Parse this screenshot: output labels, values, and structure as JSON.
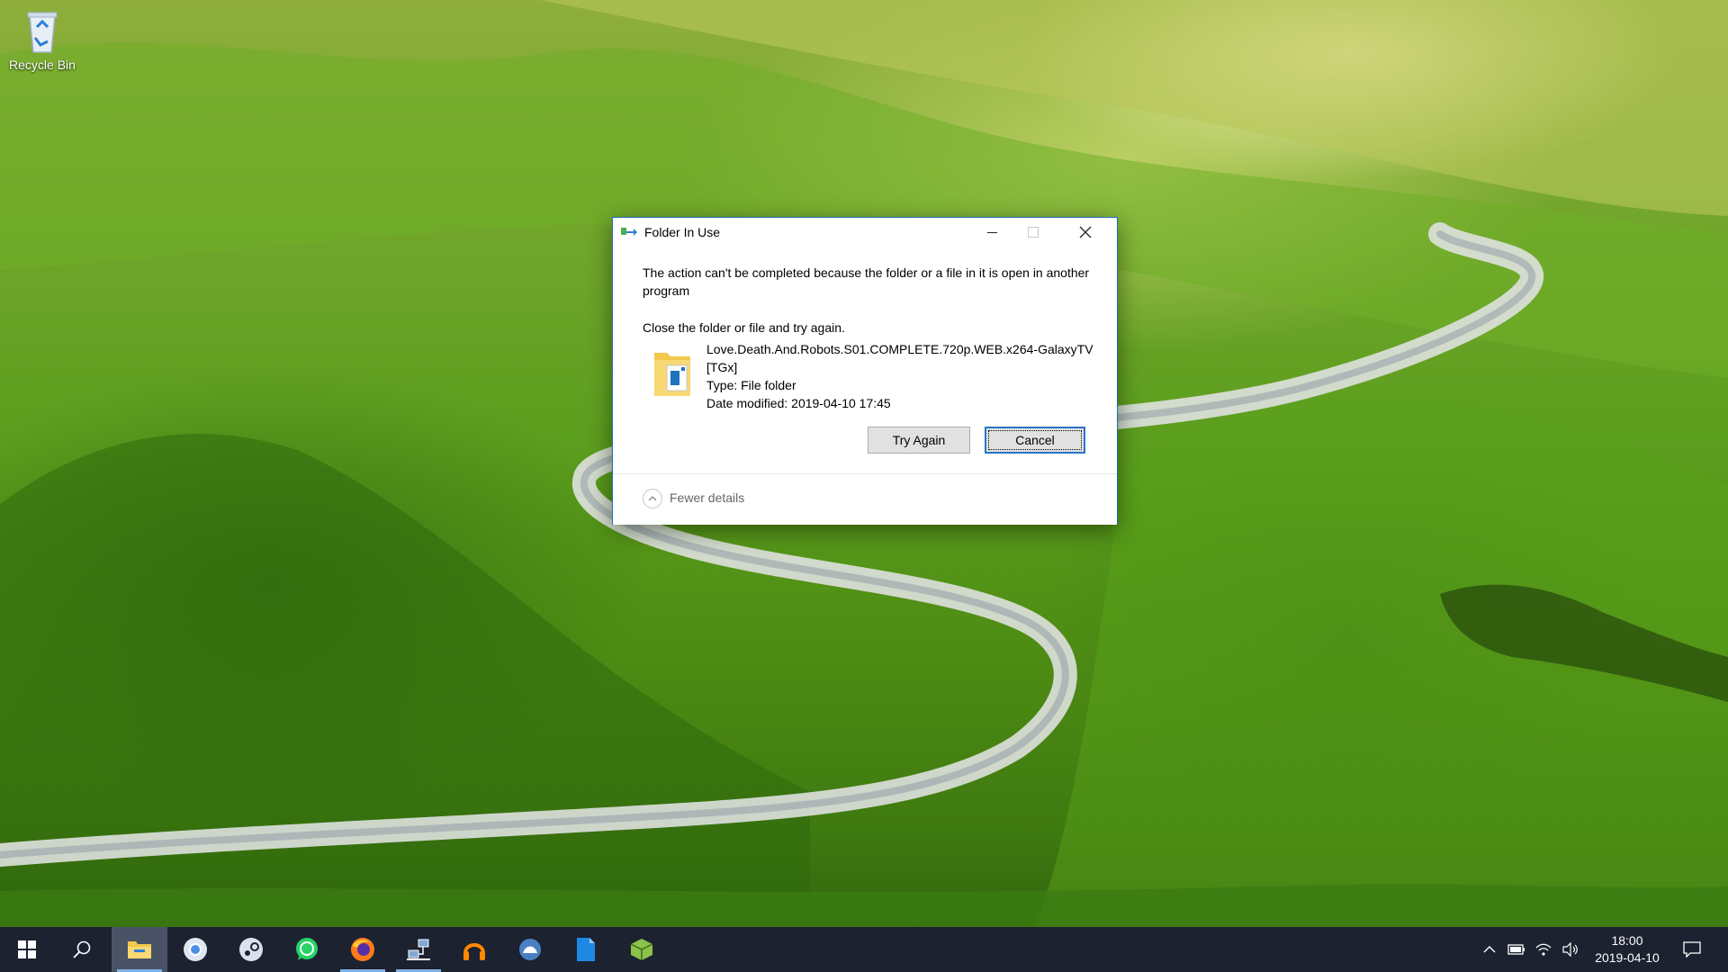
{
  "desktop": {
    "icons": [
      {
        "label": "Recycle Bin",
        "icon": "recycle-bin-icon"
      }
    ]
  },
  "dialog": {
    "title": "Folder In Use",
    "message_line1": "The action can't be completed because the folder or a file in it is open in another program",
    "message_line2": "Close the folder or file and try again.",
    "file": {
      "name": "Love.Death.And.Robots.S01.COMPLETE.720p.WEB.x264-GalaxyTV[TGx]",
      "type": "Type: File folder",
      "date_modified": "Date modified: 2019-04-10 17:45"
    },
    "buttons": {
      "try_again": "Try Again",
      "cancel": "Cancel"
    },
    "details_toggle": "Fewer details"
  },
  "taskbar": {
    "items": [
      {
        "icon": "windows-start-icon"
      },
      {
        "icon": "search-icon"
      },
      {
        "icon": "file-explorer-icon",
        "state": "active"
      },
      {
        "icon": "chrome-icon"
      },
      {
        "icon": "steam-icon"
      },
      {
        "icon": "whatsapp-icon"
      },
      {
        "icon": "firefox-icon"
      },
      {
        "icon": "network-app-icon",
        "state": "running"
      },
      {
        "icon": "headphones-app-icon"
      },
      {
        "icon": "blue-circle-app-icon"
      },
      {
        "icon": "blue-document-app-icon"
      },
      {
        "icon": "green-cube-app-icon"
      }
    ],
    "tray": [
      "chevron-up-icon",
      "battery-icon",
      "wifi-icon",
      "volume-icon"
    ],
    "clock": {
      "time": "18:00",
      "date": "2019-04-10"
    },
    "notifications_icon": "action-center-icon"
  },
  "colors": {
    "taskbar": "#1c2230",
    "dialog_border": "#1f6fb5",
    "button_focus": "#2a74c9"
  }
}
